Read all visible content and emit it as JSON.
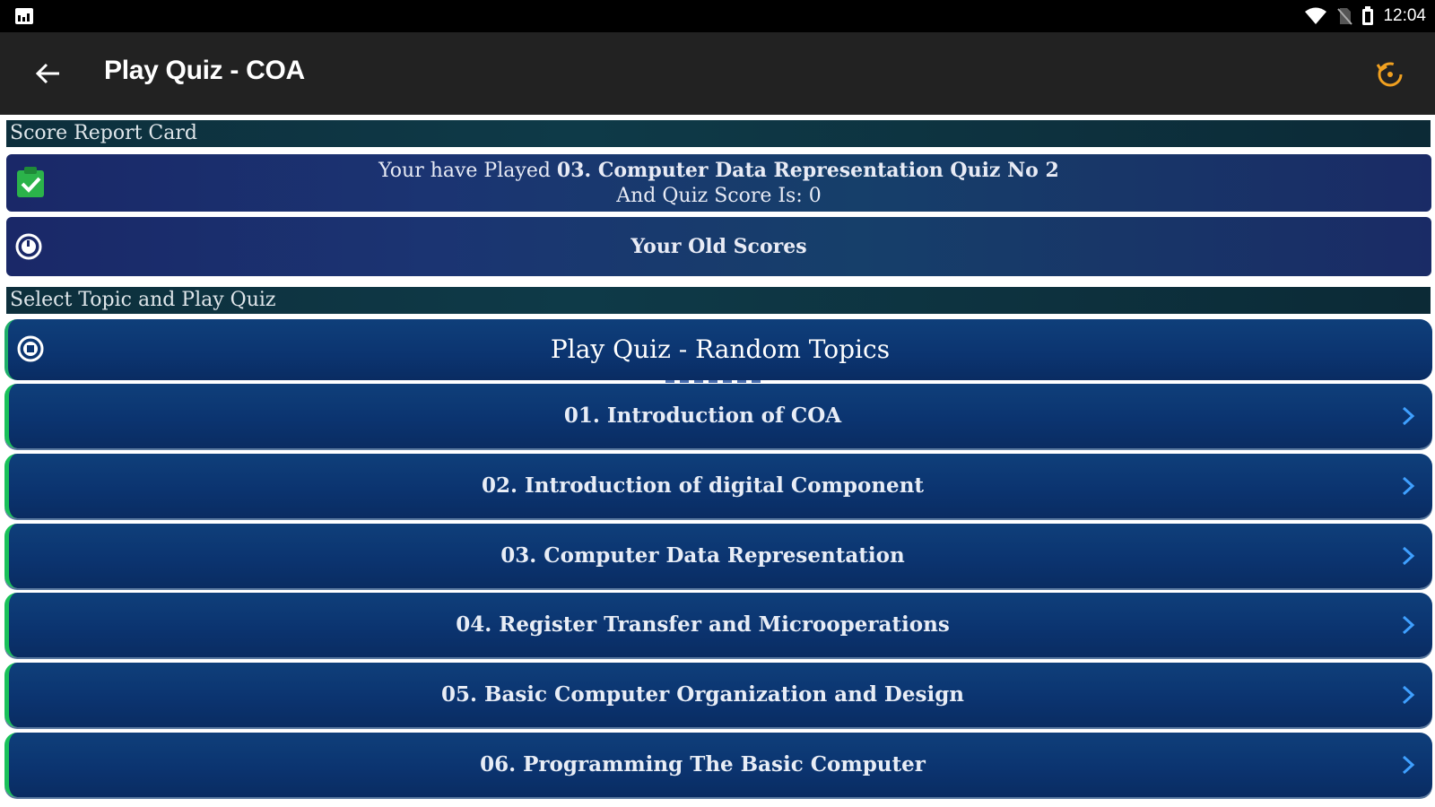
{
  "status_bar": {
    "time": "12:04"
  },
  "app_bar": {
    "title": "Play Quiz - COA"
  },
  "score_section": {
    "header": "Score Report Card",
    "played_prefix": "Your have Played",
    "played_quiz": "03. Computer Data Representation Quiz No 2",
    "score_line": "And Quiz Score Is: 0",
    "old_scores_label": "Your Old Scores"
  },
  "topics_section": {
    "header": "Select Topic and Play Quiz",
    "random_label": "Play Quiz - Random Topics",
    "items": [
      {
        "label": "01. Introduction of COA"
      },
      {
        "label": "02. Introduction of digital Component"
      },
      {
        "label": "03. Computer Data Representation"
      },
      {
        "label": "04. Register Transfer and Microoperations"
      },
      {
        "label": "05. Basic Computer Organization and Design"
      },
      {
        "label": "06. Programming The Basic Computer"
      }
    ]
  },
  "colors": {
    "accent_orange": "#f0a020",
    "check_green": "#2bb34a",
    "topic_edge_green": "#19c15a"
  },
  "icons": [
    "image-icon",
    "wifi-icon",
    "no-sim-icon",
    "battery-icon",
    "back-arrow-icon",
    "history-icon",
    "check-clipboard-icon",
    "timer-icon",
    "shuffle-icon",
    "chevron-right-icon"
  ]
}
